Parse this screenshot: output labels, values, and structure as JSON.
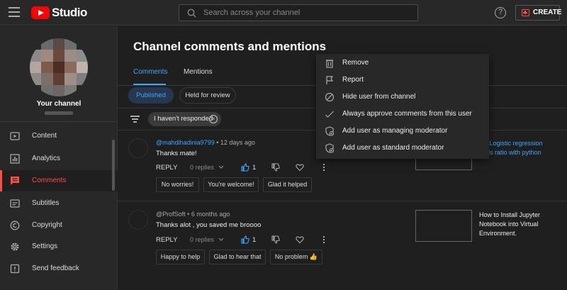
{
  "app": {
    "logo_text": "Studio"
  },
  "search": {
    "placeholder": "Search across your channel"
  },
  "header": {
    "help_glyph": "?",
    "create_label": "CREATE"
  },
  "sidebar": {
    "channel_title": "Your channel",
    "items": [
      {
        "label": "Content",
        "icon": "video-icon",
        "active": false
      },
      {
        "label": "Analytics",
        "icon": "bar-chart-icon",
        "active": false
      },
      {
        "label": "Comments",
        "icon": "comment-icon",
        "active": true
      },
      {
        "label": "Subtitles",
        "icon": "subtitles-icon",
        "active": false
      },
      {
        "label": "Copyright",
        "icon": "copyright-icon",
        "active": false
      },
      {
        "label": "Settings",
        "icon": "gear-icon",
        "active": false
      },
      {
        "label": "Send feedback",
        "icon": "feedback-icon",
        "active": false
      }
    ]
  },
  "main": {
    "title": "Channel comments and mentions",
    "tabs": [
      {
        "label": "Comments",
        "active": true
      },
      {
        "label": "Mentions",
        "active": false
      }
    ],
    "filter_pills": [
      {
        "label": "Published",
        "selected": true
      },
      {
        "label": "Held for review",
        "selected": false
      }
    ],
    "filter_chip": {
      "label": "I haven't responded",
      "remove_glyph": "×"
    }
  },
  "comments": [
    {
      "author": "@mahdihadinia9799",
      "time": "12 days ago",
      "text": "Thanks mate!",
      "reply_label": "REPLY",
      "replies_label": "0 replies",
      "likes": "1",
      "liked": true,
      "quick_replies": [
        "No worries!",
        "You're welcome!",
        "Glad it helped"
      ],
      "video_title": "ple Logistic regression odds ratio with python"
    },
    {
      "author": "@ProfSoft",
      "time": "6 months ago",
      "text": "Thanks alot , you saved me broooo",
      "reply_label": "REPLY",
      "replies_label": "0 replies",
      "likes": "1",
      "liked": true,
      "quick_replies": [
        "Happy to help",
        "Glad to hear that",
        "No problem 👍"
      ],
      "video_title": "How to Install Jupyter Notebook into  Virtual Environment."
    }
  ],
  "meta_separator": "•",
  "context_menu": {
    "items": [
      {
        "label": "Remove",
        "icon": "trash-icon"
      },
      {
        "label": "Report",
        "icon": "flag-icon"
      },
      {
        "label": "Hide user from channel",
        "icon": "block-icon"
      },
      {
        "label": "Always approve comments from this user",
        "icon": "check-icon"
      },
      {
        "label": "Add user as managing moderator",
        "icon": "shield-add-icon"
      },
      {
        "label": "Add user as standard moderator",
        "icon": "shield-add-icon"
      }
    ]
  },
  "colors": {
    "accent": "#3ea6ff",
    "brand": "#ff0000",
    "active_nav": "#ff4e45",
    "background": "#1f1f1f",
    "surface": "#282828"
  }
}
